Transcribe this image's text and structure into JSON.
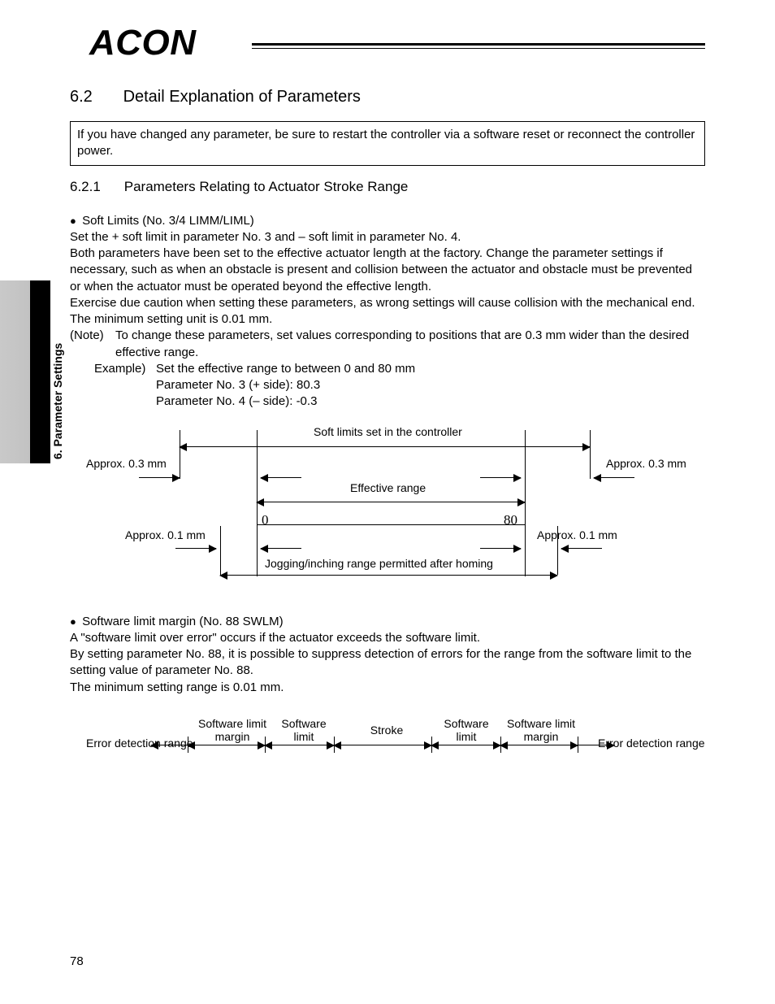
{
  "brand": "ACON",
  "sidebar": "6. Parameter Settings",
  "section": {
    "num": "6.2",
    "title": "Detail Explanation of Parameters"
  },
  "boxnote": "If you have changed any parameter, be sure to restart the controller via a software reset or reconnect the controller power.",
  "subsection": {
    "num": "6.2.1",
    "title": "Parameters Relating to Actuator Stroke Range"
  },
  "soft": {
    "bullet": "Soft Limits (No. 3/4 LIMM/LIML)",
    "p1": "Set the + soft limit in parameter No. 3 and – soft limit in parameter No. 4.",
    "p2": "Both parameters have been set to the effective actuator length at the factory. Change the parameter settings if necessary, such as when an obstacle is present and collision between the actuator and obstacle must be prevented or when the actuator must be operated beyond the effective length.",
    "p3": "Exercise due caution when setting these parameters, as wrong settings will cause collision with the mechanical end.",
    "p4": "The minimum setting unit is 0.01 mm.",
    "note_tag": "(Note)",
    "note": "To change these parameters, set values corresponding to positions that are 0.3 mm wider than the desired effective range.",
    "ex_tag": "Example)",
    "ex1": "Set the effective range to between 0 and 80 mm",
    "ex2": "Parameter No. 3 (+ side): 80.3",
    "ex3": "Parameter No. 4 (– side): -0.3"
  },
  "diag1": {
    "top": "Soft limits set in the controller",
    "l03": "Approx. 0.3 mm",
    "r03": "Approx. 0.3 mm",
    "eff": "Effective range",
    "l01": "Approx. 0.1 mm",
    "r01": "Approx. 0.1 mm",
    "zero": "0",
    "eighty": "80",
    "jog": "Jogging/inching range permitted after homing"
  },
  "swlm": {
    "bullet": "Software limit margin (No. 88 SWLM)",
    "p1": "A \"software limit over error\" occurs if the actuator exceeds the software limit.",
    "p2": "By setting parameter No. 88, it is possible to suppress detection of errors for the range from the software limit to the setting value of parameter No. 88.",
    "p3": "The minimum setting range is 0.01 mm."
  },
  "diag2": {
    "edl": "Error detection range",
    "edr": "Error detection range",
    "slm": "Software limit margin",
    "sl": "Software limit",
    "stroke": "Stroke"
  },
  "page_number": "78"
}
